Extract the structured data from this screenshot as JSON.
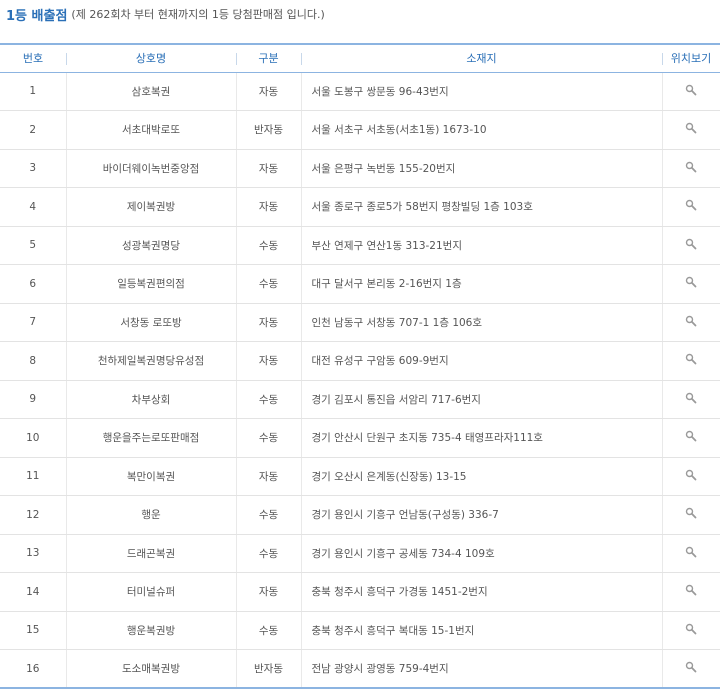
{
  "header": {
    "title": "1등 배출점",
    "subtitle": "(제 262회차 부터 현재까지의 1등 당첨판매점 입니다.)"
  },
  "table": {
    "columns": [
      "번호",
      "상호명",
      "구분",
      "소재지",
      "위치보기"
    ],
    "rows": [
      {
        "no": "1",
        "name": "삼호복권",
        "type": "자동",
        "address": "서울 도봉구 쌍문동 96-43번지"
      },
      {
        "no": "2",
        "name": "서초대박로또",
        "type": "반자동",
        "address": "서울 서초구 서초동(서초1동) 1673-10"
      },
      {
        "no": "3",
        "name": "바이더웨이녹번중앙점",
        "type": "자동",
        "address": "서울 은평구 녹번동 155-20번지"
      },
      {
        "no": "4",
        "name": "제이복권방",
        "type": "자동",
        "address": "서울 종로구 종로5가 58번지 평창빌딩 1층 103호"
      },
      {
        "no": "5",
        "name": "성광복권명당",
        "type": "수동",
        "address": "부산 연제구 연산1동 313-21번지"
      },
      {
        "no": "6",
        "name": "일등복권편의점",
        "type": "수동",
        "address": "대구 달서구 본리동 2-16번지 1층"
      },
      {
        "no": "7",
        "name": "서창동 로또방",
        "type": "자동",
        "address": "인천 남동구 서창동 707-1 1층 106호"
      },
      {
        "no": "8",
        "name": "천하제일복권명당유성점",
        "type": "자동",
        "address": "대전 유성구 구암동 609-9번지"
      },
      {
        "no": "9",
        "name": "차부상회",
        "type": "수동",
        "address": "경기 김포시 통진읍 서암리 717-6번지"
      },
      {
        "no": "10",
        "name": "행운을주는로또판매점",
        "type": "수동",
        "address": "경기 안산시 단원구 초지동 735-4 태영프라자111호"
      },
      {
        "no": "11",
        "name": "복만이복권",
        "type": "자동",
        "address": "경기 오산시 은계동(신장동) 13-15"
      },
      {
        "no": "12",
        "name": "행운",
        "type": "수동",
        "address": "경기 용인시 기흥구 언남동(구성동) 336-7"
      },
      {
        "no": "13",
        "name": "드래곤복권",
        "type": "수동",
        "address": "경기 용인시 기흥구 공세동 734-4 109호"
      },
      {
        "no": "14",
        "name": "터미널슈퍼",
        "type": "자동",
        "address": "충북 청주시 흥덕구 가경동 1451-2번지"
      },
      {
        "no": "15",
        "name": "행운복권방",
        "type": "수동",
        "address": "충북 청주시 흥덕구 복대동 15-1번지"
      },
      {
        "no": "16",
        "name": "도소매복권방",
        "type": "반자동",
        "address": "전남 광양시 광영동 759-4번지"
      }
    ]
  },
  "icons": {
    "location": "magnifier-icon"
  }
}
